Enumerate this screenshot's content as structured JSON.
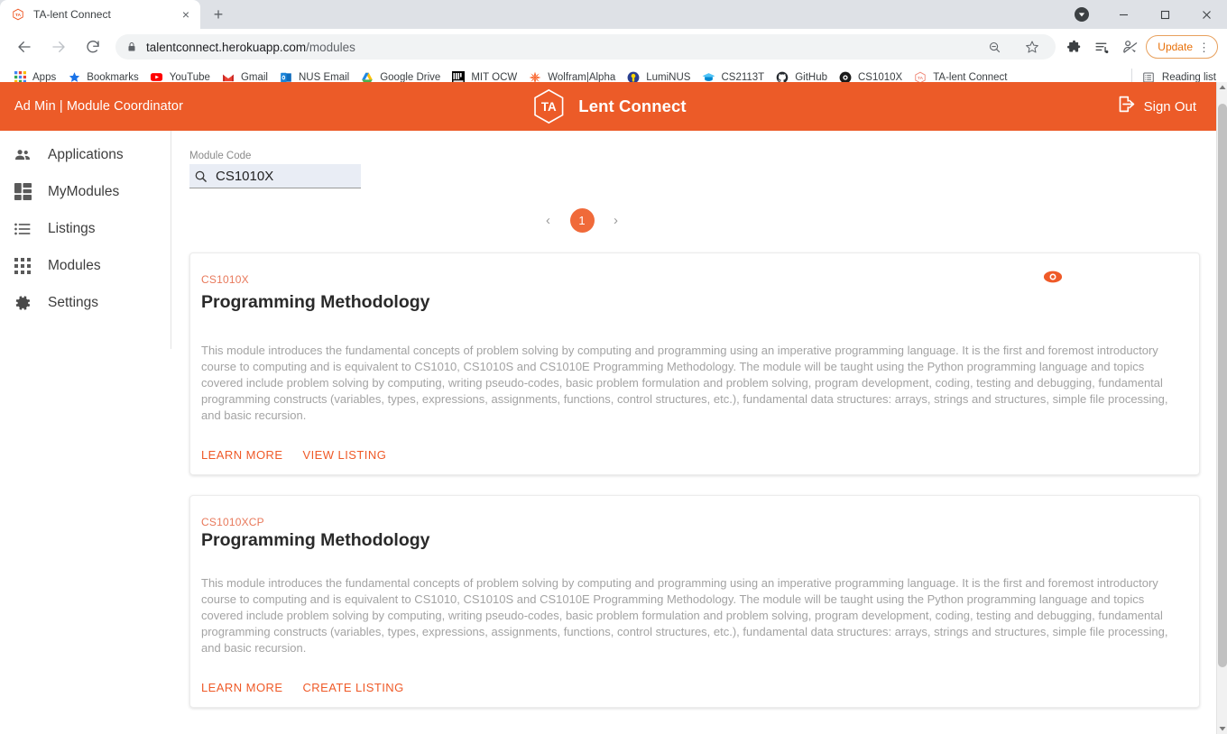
{
  "browser": {
    "tab": {
      "title": "TA-lent Connect",
      "favicon": "ta-hexagon-icon",
      "close": "×"
    },
    "new_tab_label": "+",
    "window_controls": {
      "profile": "profile-avatar",
      "minimize": "—",
      "maximize": "❐",
      "close": "✕"
    },
    "nav": {
      "back": "←",
      "forward": "→",
      "reload": "↻"
    },
    "omnibox": {
      "host": "talentconnect.herokuapp.com",
      "path": "/modules",
      "lock_icon": "lock-icon"
    },
    "toolbar_icons": [
      "zoom-out-icon",
      "bookmark-star-icon",
      "extensions-puzzle-icon",
      "reading-list-icon",
      "sync-paused-icon"
    ],
    "update_button": {
      "label": "Update",
      "menu": "⋮",
      "color": "#e8710a"
    },
    "bookmarks": [
      {
        "label": "Apps",
        "icon": "apps-grid-icon"
      },
      {
        "label": "Bookmarks",
        "icon": "star-icon"
      },
      {
        "label": "YouTube",
        "icon": "youtube-icon"
      },
      {
        "label": "Gmail",
        "icon": "gmail-icon"
      },
      {
        "label": "NUS Email",
        "icon": "outlook-icon"
      },
      {
        "label": "Google Drive",
        "icon": "drive-icon"
      },
      {
        "label": "MIT OCW",
        "icon": "mit-ocw-icon"
      },
      {
        "label": "Wolfram|Alpha",
        "icon": "wolfram-icon"
      },
      {
        "label": "LumiNUS",
        "icon": "luminus-icon"
      },
      {
        "label": "CS2113T",
        "icon": "graduation-cap-icon"
      },
      {
        "label": "GitHub",
        "icon": "github-icon"
      },
      {
        "label": "CS1010X",
        "icon": "coursemology-icon"
      },
      {
        "label": "TA-lent Connect",
        "icon": "ta-hexagon-icon"
      }
    ],
    "reading_list": {
      "label": "Reading list",
      "icon": "reading-list-icon"
    }
  },
  "app": {
    "header": {
      "user": "Ad Min | Module Coordinator",
      "logo_text": "TA",
      "brand": "Lent Connect",
      "sign_out": "Sign Out",
      "bar_color": "#ec5b28"
    },
    "sidebar": {
      "items": [
        {
          "label": "Applications",
          "icon": "people-icon"
        },
        {
          "label": "MyModules",
          "icon": "dashboard-icon"
        },
        {
          "label": "Listings",
          "icon": "list-icon"
        },
        {
          "label": "Modules",
          "icon": "apps-grid-icon"
        },
        {
          "label": "Settings",
          "icon": "gear-icon"
        }
      ]
    },
    "search": {
      "label": "Module Code",
      "value": "CS1010X",
      "placeholder": "",
      "icon": "search-icon"
    },
    "pagination": {
      "prev": "‹",
      "next": "›",
      "current": "1"
    },
    "cards": [
      {
        "code": "CS1010X",
        "title": "Programming Methodology",
        "description": "This module introduces the fundamental concepts of problem solving by computing and programming using an imperative programming language. It is the first and foremost introductory course to computing and is equivalent to CS1010, CS1010S and CS1010E Programming Methodology. The module will be taught using the Python programming language and topics covered include problem solving by computing, writing pseudo-codes, basic problem formulation and problem solving, program development, coding, testing and debugging, fundamental programming constructs (variables, types, expressions, assignments, functions, control structures, etc.), fundamental data structures: arrays, strings and structures, simple file processing, and basic recursion.",
        "primary_action": "LEARN MORE",
        "secondary_action": "VIEW LISTING",
        "has_visibility_icon": true,
        "visibility_icon": "eye-icon"
      },
      {
        "code": "CS1010XCP",
        "title": "Programming Methodology",
        "description": "This module introduces the fundamental concepts of problem solving by computing and programming using an imperative programming language. It is the first and foremost introductory course to computing and is equivalent to CS1010, CS1010S and CS1010E Programming Methodology. The module will be taught using the Python programming language and topics covered include problem solving by computing, writing pseudo-codes, basic problem formulation and problem solving, program development, coding, testing and debugging, fundamental programming constructs (variables, types, expressions, assignments, functions, control structures, etc.), fundamental data structures: arrays, strings and structures, simple file processing, and basic recursion.",
        "primary_action": "LEARN MORE",
        "secondary_action": "CREATE LISTING",
        "has_visibility_icon": false,
        "visibility_icon": ""
      }
    ],
    "colors": {
      "accent": "#ef5a28",
      "header": "#ec5b28",
      "code_text": "#e8795b",
      "body_text": "#a3a3a3"
    }
  }
}
